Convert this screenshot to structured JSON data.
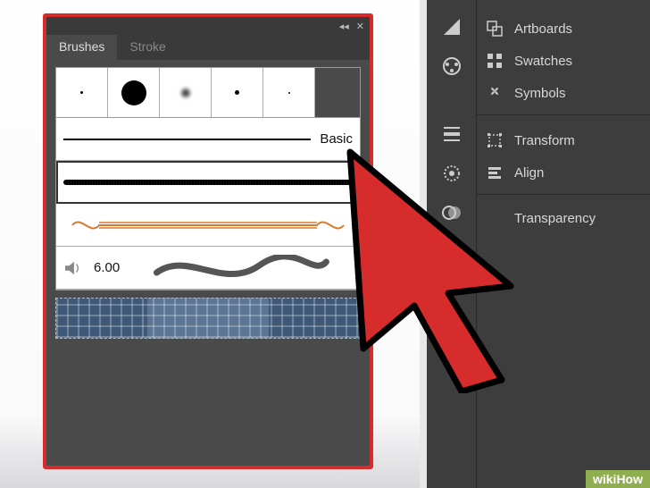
{
  "brushesPanel": {
    "tabs": {
      "brushes": "Brushes",
      "stroke": "Stroke"
    },
    "basicLabel": "Basic",
    "wavy": {
      "value": "6.00"
    }
  },
  "rightPanel": {
    "items": {
      "artboards": "Artboards",
      "swatches": "Swatches",
      "symbols": "Symbols",
      "transform": "Transform",
      "align": "Align",
      "transparency": "Transparency"
    }
  },
  "watermark": "wikiHow"
}
